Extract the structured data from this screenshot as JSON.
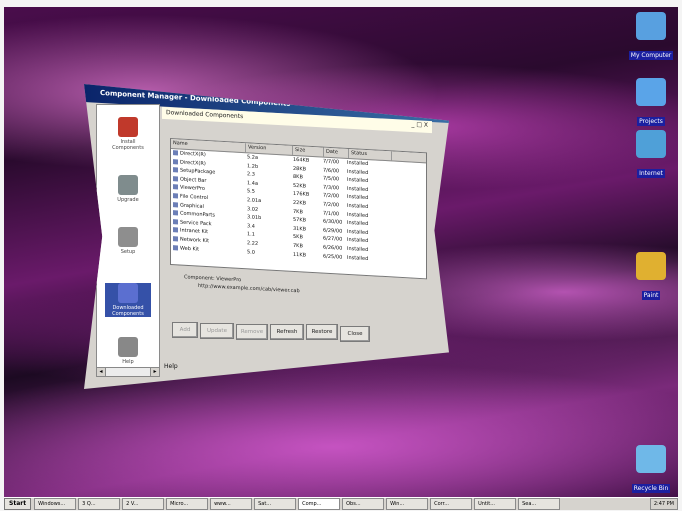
{
  "desktop": {
    "icons": [
      {
        "id": "my-computer",
        "label": "My Computer",
        "color": "#58a0e0"
      },
      {
        "id": "projects",
        "label": "Projects",
        "color": "#5aa4e8"
      },
      {
        "id": "internet",
        "label": "Internet",
        "color": "#4fa0d8"
      },
      {
        "id": "paint",
        "label": "Paint",
        "color": "#e0b030"
      },
      {
        "id": "recycle-bin",
        "label": "Recycle Bin",
        "color": "#6fb8e8"
      }
    ]
  },
  "window": {
    "title": "Component Manager - Downloaded Components",
    "header": "Downloaded Components",
    "controls": "_ □ X",
    "sidebar": [
      {
        "label": "Install Components",
        "icon": "install-icon",
        "color": "#c0392b"
      },
      {
        "label": "Upgrade",
        "icon": "upgrade-icon",
        "color": "#7f8c8d"
      },
      {
        "label": "Setup",
        "icon": "setup-icon",
        "color": "#8e8e8e"
      },
      {
        "label": "Downloaded Components",
        "icon": "components-icon",
        "color": "#5b6fd0",
        "selected": true
      },
      {
        "label": "Help",
        "icon": "help-icon",
        "color": "#888888"
      }
    ],
    "columns": [
      "Name",
      "Version",
      "Size",
      "Date",
      "Status"
    ],
    "rows": [
      [
        "DirectX(R)",
        "5.2a",
        "164KB",
        "7/7/00",
        "Installed"
      ],
      [
        "DirectX(R)",
        "1.2b",
        "28KB",
        "7/6/00",
        "Installed"
      ],
      [
        "SetupPackage",
        "2.3",
        "8KB",
        "7/5/00",
        "Installed"
      ],
      [
        "Object Bar",
        "1.4a",
        "52KB",
        "7/3/00",
        "Installed"
      ],
      [
        "ViewerPro",
        "5.5",
        "176KB",
        "7/2/00",
        "Installed"
      ],
      [
        "File Control",
        "2.01a",
        "22KB",
        "7/2/00",
        "Installed"
      ],
      [
        "Graphical",
        "3.02",
        "7KB",
        "7/1/00",
        "Installed"
      ],
      [
        "CommonParts",
        "3.01b",
        "57KB",
        "6/30/00",
        "Installed"
      ],
      [
        "Service Pack",
        "3.4",
        "31KB",
        "6/29/00",
        "Installed"
      ],
      [
        "Intranet Kit",
        "1.1",
        "5KB",
        "6/27/00",
        "Installed"
      ],
      [
        "Network Kit",
        "2.22",
        "7KB",
        "6/26/00",
        "Installed"
      ],
      [
        "Web Kit",
        "5.0",
        "11KB",
        "6/25/00",
        "Installed"
      ]
    ],
    "component_label": "Component: ViewerPro",
    "component_path": "http://www.example.com/cab/viewer.cab",
    "buttons": [
      {
        "label": "Add",
        "enabled": false
      },
      {
        "label": "Update",
        "enabled": false
      },
      {
        "label": "Remove",
        "enabled": false
      },
      {
        "label": "Refresh",
        "enabled": true
      },
      {
        "label": "Restore",
        "enabled": true
      },
      {
        "label": "Close",
        "enabled": true
      }
    ],
    "close_label": "Close",
    "help_label": "Help"
  },
  "taskbar": {
    "start": "Start",
    "buttons": [
      "Windows...",
      "3 Q...",
      "2 V...",
      "Micro...",
      "www...",
      "Sat...",
      "Comp...",
      "Obs...",
      "Win...",
      "Corr...",
      "Untit...",
      "Sea..."
    ],
    "active_index": 6,
    "clock": "2:47 PM"
  }
}
